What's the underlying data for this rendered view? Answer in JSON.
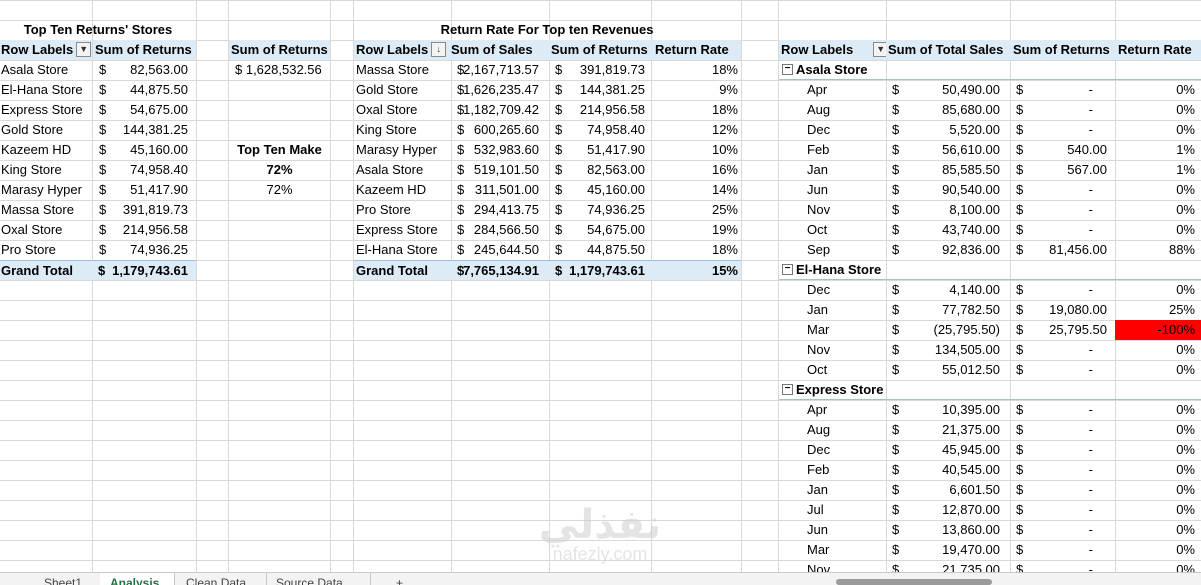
{
  "tables": {
    "top_returns": {
      "title": "Top Ten Returns' Stores",
      "headers": [
        "Row Labels",
        "Sum of Returns"
      ],
      "rows": [
        [
          "Asala Store",
          "82,563.00"
        ],
        [
          "El-Hana Store",
          "44,875.50"
        ],
        [
          "Express Store",
          "54,675.00"
        ],
        [
          "Gold Store",
          "144,381.25"
        ],
        [
          "Kazeem HD",
          "45,160.00"
        ],
        [
          "King Store",
          "74,958.40"
        ],
        [
          "Marasy Hyper",
          "51,417.90"
        ],
        [
          "Massa Store",
          "391,819.73"
        ],
        [
          "Oxal Store",
          "214,956.58"
        ],
        [
          "Pro Store",
          "74,936.25"
        ]
      ],
      "total_label": "Grand Total",
      "total_value": "1,179,743.61"
    },
    "sum_returns": {
      "header": "Sum of Returns",
      "value": "$  1,628,532.56",
      "top_ten_label": "Top Ten Make",
      "pct_bold": "72%",
      "pct": "72%"
    },
    "return_rate": {
      "title": "Return Rate For Top ten Revenues",
      "headers": [
        "Row Labels",
        "Sum of Sales",
        "Sum of Returns",
        "Return Rate"
      ],
      "rows": [
        [
          "Massa Store",
          "2,167,713.57",
          "391,819.73",
          "18%"
        ],
        [
          "Gold Store",
          "1,626,235.47",
          "144,381.25",
          "9%"
        ],
        [
          "Oxal Store",
          "1,182,709.42",
          "214,956.58",
          "18%"
        ],
        [
          "King Store",
          "600,265.60",
          "74,958.40",
          "12%"
        ],
        [
          "Marasy Hyper",
          "532,983.60",
          "51,417.90",
          "10%"
        ],
        [
          "Asala Store",
          "519,101.50",
          "82,563.00",
          "16%"
        ],
        [
          "Kazeem HD",
          "311,501.00",
          "45,160.00",
          "14%"
        ],
        [
          "Pro Store",
          "294,413.75",
          "74,936.25",
          "25%"
        ],
        [
          "Express Store",
          "284,566.50",
          "54,675.00",
          "19%"
        ],
        [
          "El-Hana Store",
          "245,644.50",
          "44,875.50",
          "18%"
        ]
      ],
      "total": [
        "Grand Total",
        "7,765,134.91",
        "1,179,743.61",
        "15%"
      ]
    },
    "monthly": {
      "headers": [
        "Row Labels",
        "Sum of Total Sales",
        "Sum of Returns",
        "Return Rate"
      ],
      "groups": [
        {
          "name": "Asala Store",
          "rows": [
            [
              "Apr",
              "50,490.00",
              "-",
              "0%"
            ],
            [
              "Aug",
              "85,680.00",
              "-",
              "0%"
            ],
            [
              "Dec",
              "5,520.00",
              "-",
              "0%"
            ],
            [
              "Feb",
              "56,610.00",
              "540.00",
              "1%"
            ],
            [
              "Jan",
              "85,585.50",
              "567.00",
              "1%"
            ],
            [
              "Jun",
              "90,540.00",
              "-",
              "0%"
            ],
            [
              "Nov",
              "8,100.00",
              "-",
              "0%"
            ],
            [
              "Oct",
              "43,740.00",
              "-",
              "0%"
            ],
            [
              "Sep",
              "92,836.00",
              "81,456.00",
              "88%"
            ]
          ]
        },
        {
          "name": "El-Hana Store",
          "rows": [
            [
              "Dec",
              "4,140.00",
              "-",
              "0%"
            ],
            [
              "Jan",
              "77,782.50",
              "19,080.00",
              "25%"
            ],
            [
              "Mar",
              "(25,795.50)",
              "25,795.50",
              "-100%"
            ],
            [
              "Nov",
              "134,505.00",
              "-",
              "0%"
            ],
            [
              "Oct",
              "55,012.50",
              "-",
              "0%"
            ]
          ]
        },
        {
          "name": "Express Store",
          "rows": [
            [
              "Apr",
              "10,395.00",
              "-",
              "0%"
            ],
            [
              "Aug",
              "21,375.00",
              "-",
              "0%"
            ],
            [
              "Dec",
              "45,945.00",
              "-",
              "0%"
            ],
            [
              "Feb",
              "40,545.00",
              "-",
              "0%"
            ],
            [
              "Jan",
              "6,601.50",
              "-",
              "0%"
            ],
            [
              "Jul",
              "12,870.00",
              "-",
              "0%"
            ],
            [
              "Jun",
              "13,860.00",
              "-",
              "0%"
            ],
            [
              "Mar",
              "19,470.00",
              "-",
              "0%"
            ],
            [
              "Nov",
              "21,735.00",
              "-",
              "0%"
            ]
          ]
        }
      ]
    }
  },
  "currency": "$",
  "sheet_tabs": [
    "Sheet1",
    "Analysis",
    "Clean Data",
    "Source Data"
  ],
  "active_tab": "Analysis",
  "add_sheet_symbol": "+",
  "watermark": {
    "arabic": "نفذلي",
    "latin": "nafezly.com"
  },
  "colors": {
    "header_fill": "#ddebf7",
    "negative_fill": "#ff0000",
    "active_tab": "#217346"
  }
}
